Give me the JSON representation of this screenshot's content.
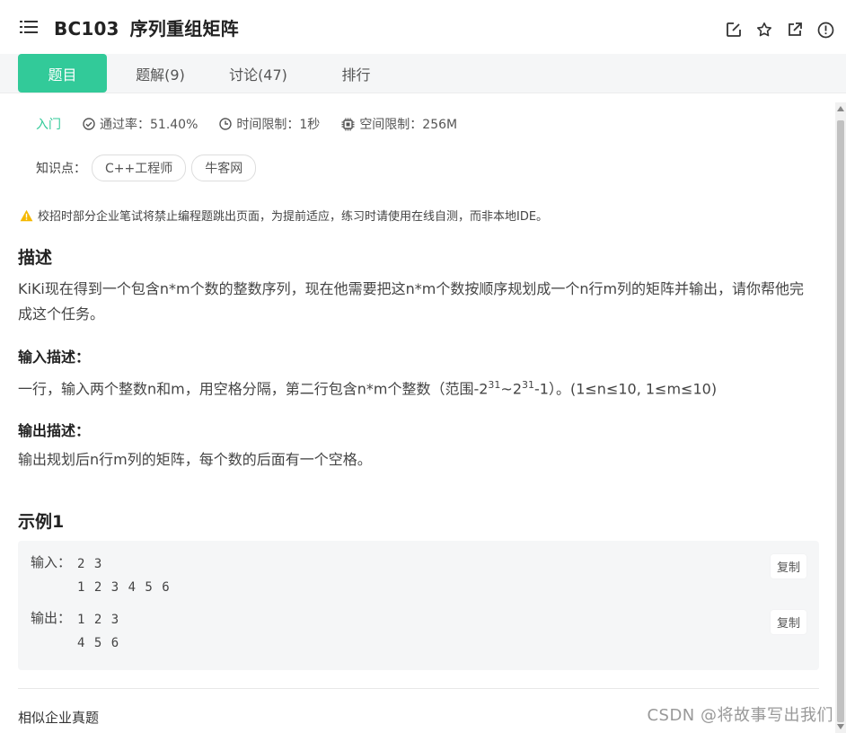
{
  "header": {
    "problem_id": "BC103",
    "problem_name": "序列重组矩阵"
  },
  "tabs": [
    {
      "label": "题目",
      "active": true
    },
    {
      "label": "题解(9)"
    },
    {
      "label": "讨论(47)"
    },
    {
      "label": "排行"
    }
  ],
  "meta": {
    "level": "入门",
    "pass_rate": "通过率：51.40%",
    "time_limit": "时间限制：1秒",
    "space_limit": "空间限制：256M"
  },
  "knowledge": {
    "label": "知识点：",
    "tags": [
      "C++工程师",
      "牛客网"
    ]
  },
  "warning": "校招时部分企业笔试将禁止编程题跳出页面，为提前适应，练习时请使用在线自测，而非本地IDE。",
  "description": {
    "title": "描述",
    "text": "KiKi现在得到一个包含n*m个数的整数序列，现在他需要把这n*m个数按顺序规划成一个n行m列的矩阵并输出，请你帮他完成这个任务。"
  },
  "input_desc": {
    "title": "输入描述：",
    "text_before": "一行，输入两个整数n和m，用空格分隔，第二行包含n*m个整数（范围-2",
    "sup1": "31",
    "text_mid": "~2",
    "sup2": "31",
    "text_after": "-1）。(1≤n≤10, 1≤m≤10)"
  },
  "output_desc": {
    "title": "输出描述：",
    "text": "输出规划后n行m列的矩阵，每个数的后面有一个空格。"
  },
  "example": {
    "title": "示例1",
    "input_label": "输入：",
    "input_value": "2 3\n1 2 3 4 5 6",
    "output_label": "输出：",
    "output_value": "1 2 3\n4 5 6",
    "copy_label": "复制"
  },
  "similar": "相似企业真题",
  "watermark": "CSDN @将故事写出我们",
  "colors": {
    "accent": "#32ca99",
    "warning": "#f5b800"
  }
}
